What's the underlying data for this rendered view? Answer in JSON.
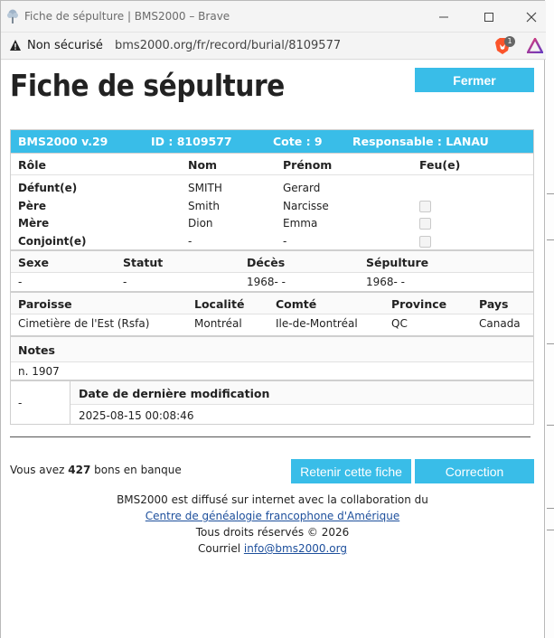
{
  "window": {
    "title": "Fiche de sépulture | BMS2000 – Brave",
    "security_label": "Non sécurisé",
    "url": "bms2000.org/fr/record/burial/8109577",
    "brave_badge": "1"
  },
  "page": {
    "title": "Fiche de sépulture",
    "close_label": "Fermer"
  },
  "record_header": {
    "version": "BMS2000 v.29",
    "id": "ID : 8109577",
    "cote": "Cote : 9",
    "responsable": "Responsable : LANAU"
  },
  "persons": {
    "headers": [
      "Rôle",
      "Nom",
      "Prénom",
      "Feu(e)"
    ],
    "rows": [
      {
        "role": "Défunt(e)",
        "nom": "SMITH",
        "prenom": "Gerard",
        "checkbox": false
      },
      {
        "role": "Père",
        "nom": "Smith",
        "prenom": "Narcisse",
        "checkbox": true
      },
      {
        "role": "Mère",
        "nom": "Dion",
        "prenom": "Emma",
        "checkbox": true
      },
      {
        "role": "Conjoint(e)",
        "nom": "-",
        "prenom": "-",
        "checkbox": true
      }
    ]
  },
  "event": {
    "headers": [
      "Sexe",
      "Statut",
      "Décès",
      "Sépulture"
    ],
    "values": [
      "-",
      "-",
      "1968- -",
      "1968- -"
    ]
  },
  "place": {
    "headers": [
      "Paroisse",
      "Localité",
      "Comté",
      "Province",
      "Pays"
    ],
    "values": [
      "Cimetière de l'Est (Rsfa)",
      "Montréal",
      "Ile-de-Montréal",
      "QC",
      "Canada"
    ]
  },
  "notes": {
    "header": "Notes",
    "value": "n. 1907"
  },
  "modification": {
    "left": "-",
    "header": "Date de dernière modification",
    "value": "2025-08-15 00:08:46"
  },
  "bank": {
    "prefix": "Vous avez",
    "count": "427",
    "suffix": "bons en banque"
  },
  "actions": {
    "keep_label": "Retenir cette fiche",
    "correction_label": "Correction"
  },
  "footer": {
    "line1": "BMS2000 est diffusé sur internet avec la collaboration du",
    "link": "Centre de généalogie francophone d'Amérique",
    "rights": "Tous droits réservés © 2026",
    "mail_prefix": "Courriel",
    "mail": "info@bms2000.org"
  },
  "colors": {
    "accent": "#39bde8",
    "link": "#1d4f9c"
  }
}
